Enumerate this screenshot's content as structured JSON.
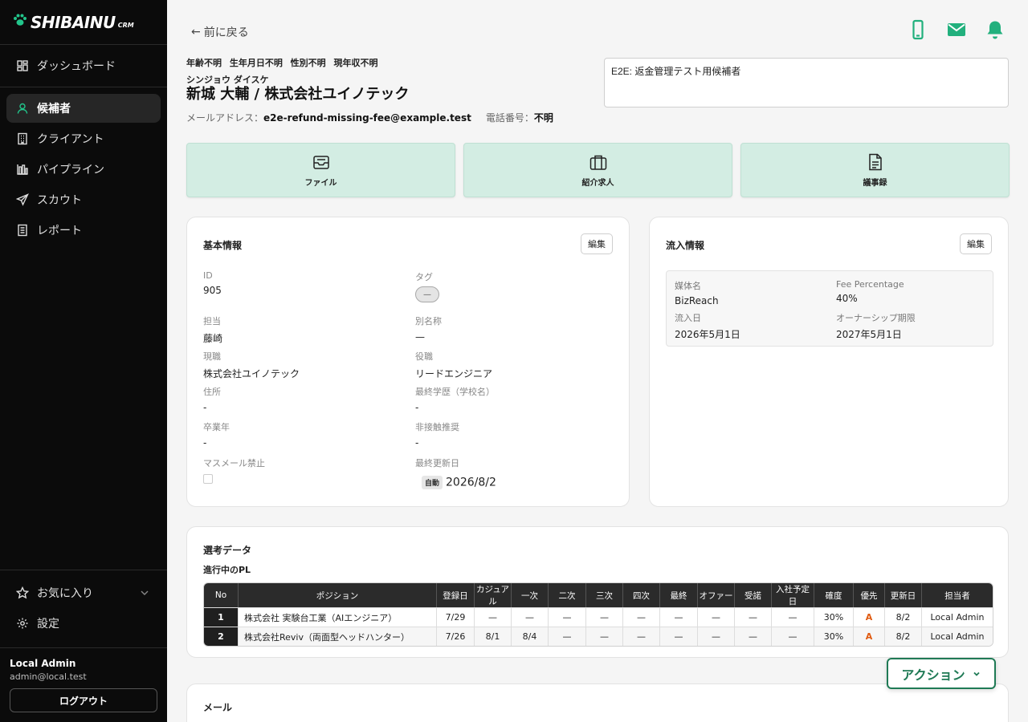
{
  "brand": {
    "name": "SHIBAINU",
    "suffix": "CRM"
  },
  "nav": {
    "items": [
      {
        "label": "ダッシュボード"
      },
      {
        "label": "候補者"
      },
      {
        "label": "クライアント"
      },
      {
        "label": "パイプライン"
      },
      {
        "label": "スカウト"
      },
      {
        "label": "レポート"
      }
    ],
    "favorites": "お気に入り",
    "settings": "設定"
  },
  "user": {
    "name": "Local Admin",
    "email": "admin@local.test",
    "logout": "ログアウト"
  },
  "header": {
    "back": "前に戻る",
    "meta": "年齢不明 生年月日不明 性別不明 現年収不明",
    "kana": "シンジョウ ダイスケ",
    "name": "新城 大輔 / 株式会社ユイノテック",
    "email_label": "メールアドレス：",
    "email": "e2e-refund-missing-fee@example.test",
    "phone_label": "電話番号：",
    "phone": "不明",
    "memo": "E2E: 返金管理テスト用候補者"
  },
  "tiles": {
    "file": "ファイル",
    "jobs": "紹介求人",
    "minutes": "議事録"
  },
  "basic": {
    "title": "基本情報",
    "edit": "編集",
    "id_label": "ID",
    "id": "905",
    "tag_label": "タグ",
    "tag": "—",
    "owner_label": "担当",
    "owner": "藤崎",
    "alias_label": "別名称",
    "alias": "—",
    "job_label": "現職",
    "job": "株式会社ユイノテック",
    "role_label": "役職",
    "role": "リードエンジニア",
    "address_label": "住所",
    "address": "-",
    "edu_label": "最終学歴（学校名）",
    "edu": "-",
    "grad_label": "卒業年",
    "grad": "-",
    "nocontact_label": "非接触推奨",
    "nocontact": "-",
    "massmail_label": "マスメール禁止",
    "updated_label": "最終更新日",
    "updated_badge": "自動",
    "updated": "2026/8/2"
  },
  "inflow": {
    "title": "流入情報",
    "edit": "編集",
    "media_label": "媒体名",
    "media": "BizReach",
    "fee_label": "Fee Percentage",
    "fee": "40%",
    "date_label": "流入日",
    "date": "2026年5月1日",
    "owner_label": "オーナーシップ期限",
    "owner_limit": "2027年5月1日"
  },
  "selection": {
    "title": "選考データ",
    "subtitle": "進行中のPL",
    "headers": [
      "No",
      "ポジション",
      "登録日",
      "カジュアル",
      "一次",
      "二次",
      "三次",
      "四次",
      "最終",
      "オファー",
      "受諾",
      "入社予定日",
      "確度",
      "優先",
      "更新日",
      "担当者"
    ],
    "rows": [
      [
        "1",
        "株式会社 実験台工業（AIエンジニア）",
        "7/29",
        "—",
        "—",
        "—",
        "—",
        "—",
        "—",
        "—",
        "—",
        "—",
        "30%",
        "A",
        "8/2",
        "Local Admin"
      ],
      [
        "2",
        "株式会社Reviv（両面型ヘッドハンター）",
        "7/26",
        "8/1",
        "8/4",
        "—",
        "—",
        "—",
        "—",
        "—",
        "—",
        "—",
        "30%",
        "A",
        "8/2",
        "Local Admin"
      ]
    ]
  },
  "mail": {
    "title": "メール"
  },
  "action": {
    "label": "アクション"
  }
}
